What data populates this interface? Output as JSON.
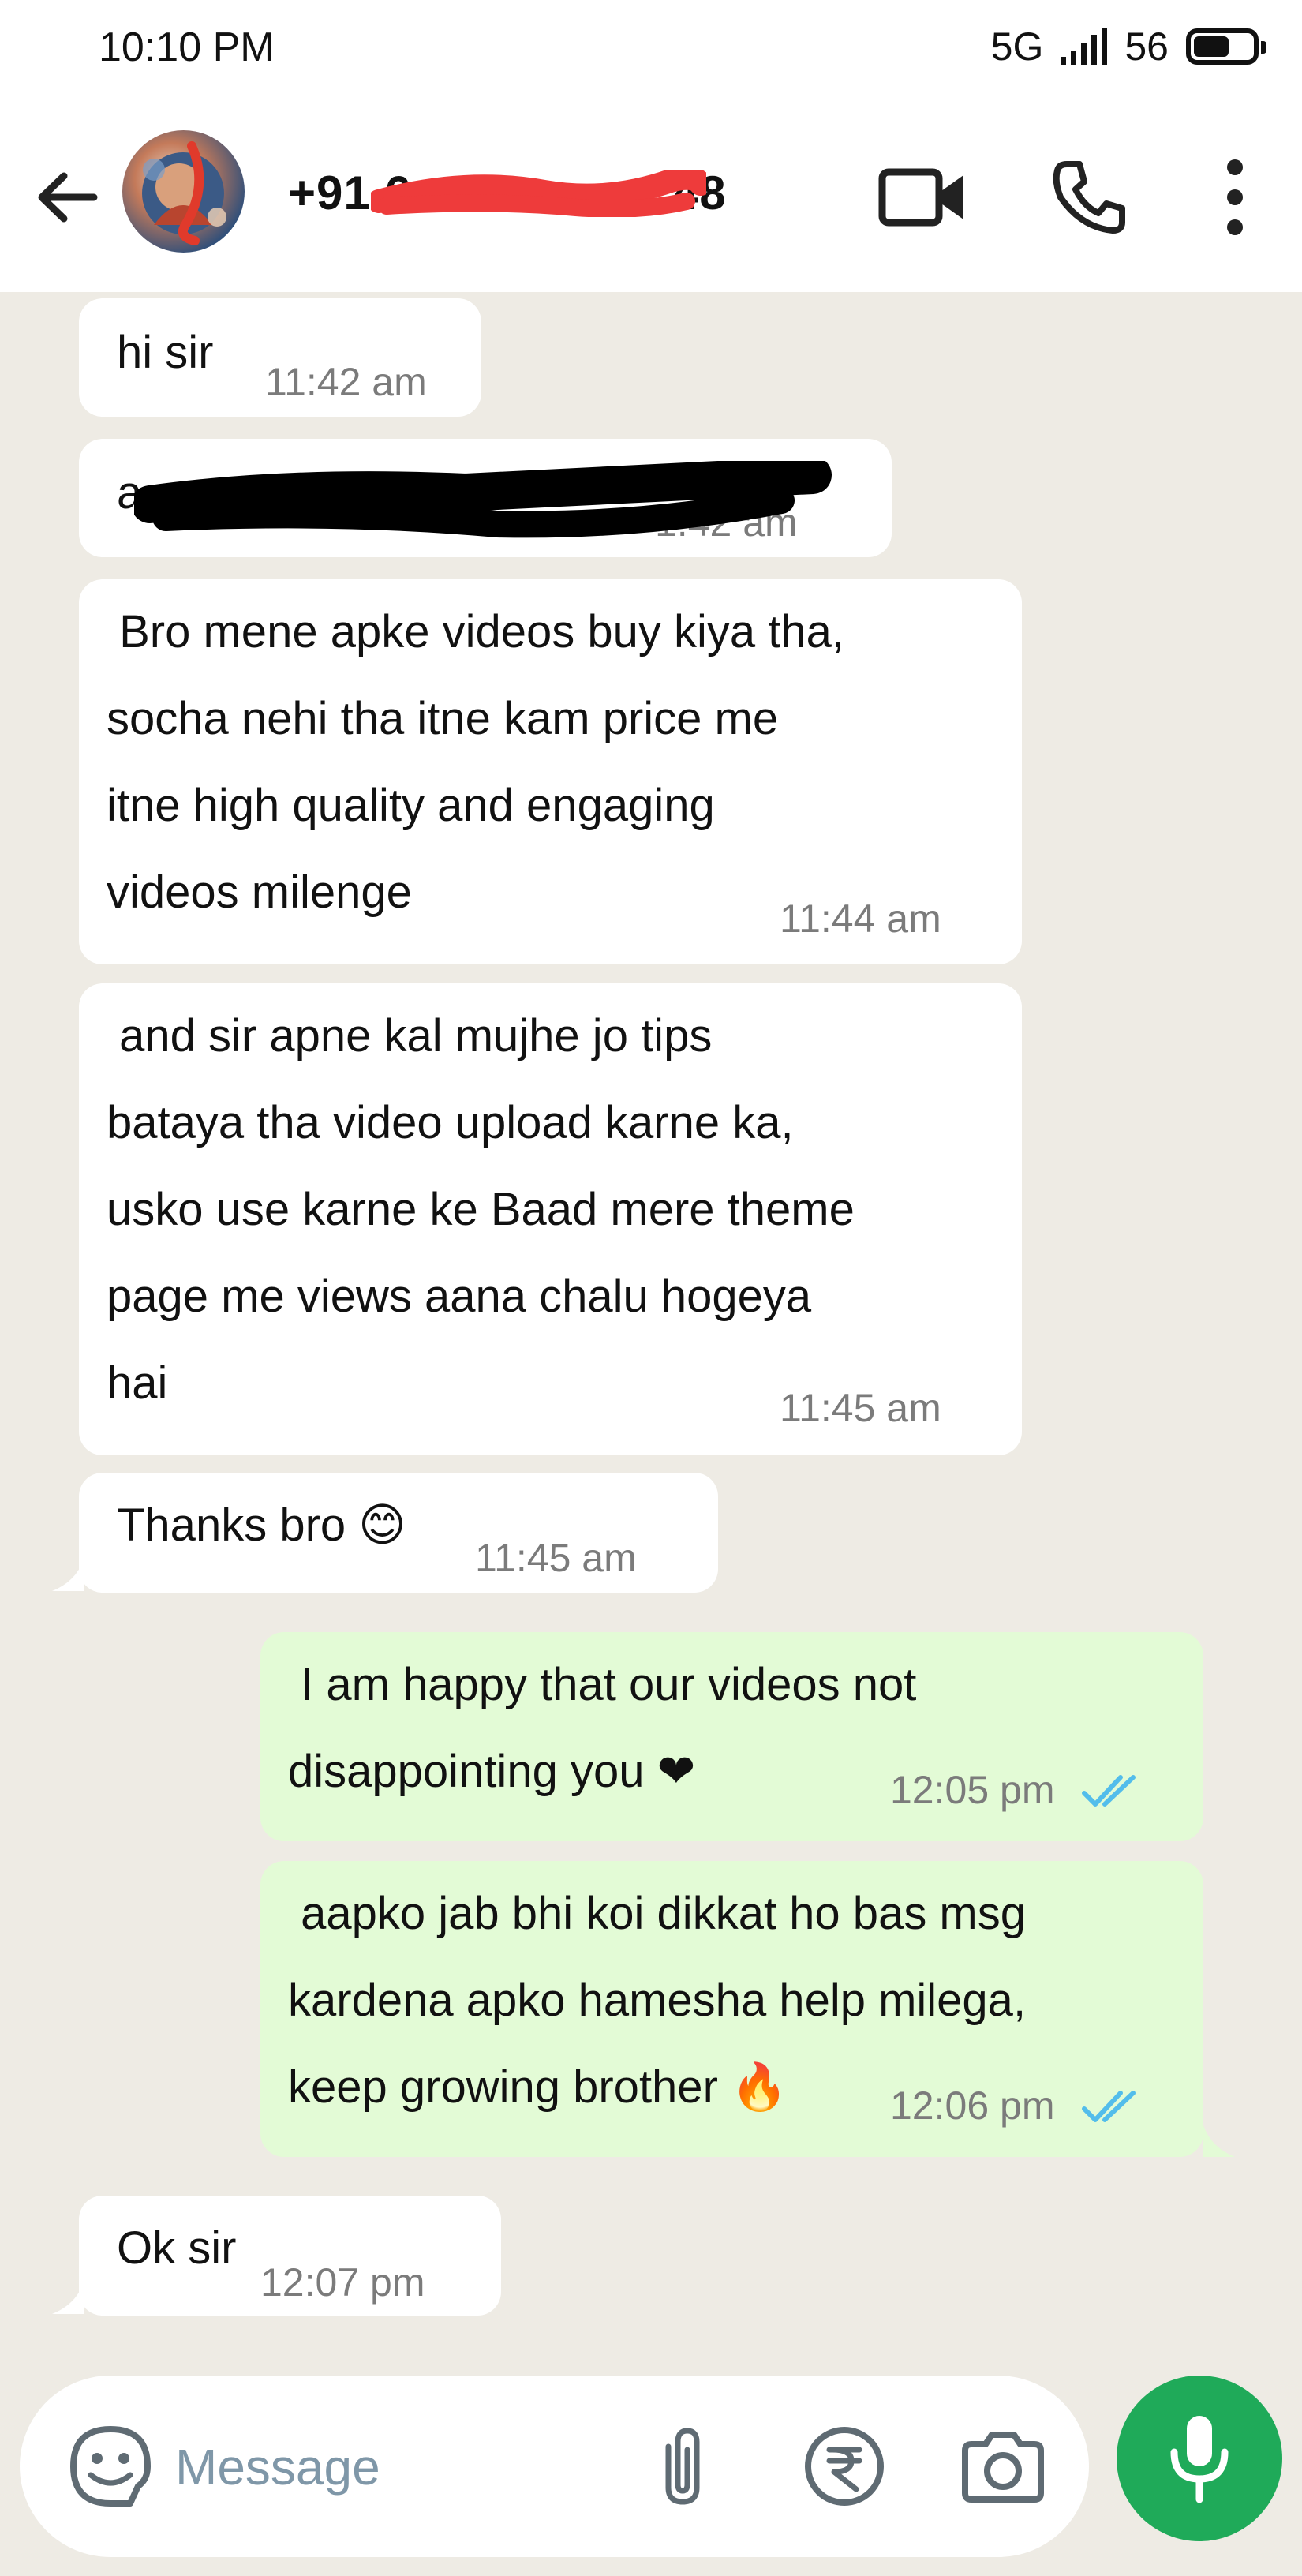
{
  "status_bar": {
    "time": "10:10 PM",
    "network": "5G",
    "battery": "56"
  },
  "header": {
    "contact_name": "+91 6",
    "contact_name_suffix": "48",
    "icons": [
      "back-arrow-icon",
      "video-call-icon",
      "phone-icon",
      "more-vert-icon"
    ]
  },
  "messages": [
    {
      "direction": "incoming",
      "text": "hi sir",
      "time": "11:42 am"
    },
    {
      "direction": "incoming",
      "text": "a",
      "time": "1:42 am"
    },
    {
      "direction": "incoming",
      "text": " Bro mene apke videos buy kiya tha,\nsocha nehi tha itne kam price me\nitne high quality and engaging\nvideos milenge",
      "time": "11:44 am"
    },
    {
      "direction": "incoming",
      "text": " and sir apne kal mujhe jo tips\nbataya tha video upload karne ka,\nusko use karne ke Baad mere theme\npage me views aana chalu hogeya\nhai",
      "time": "11:45 am"
    },
    {
      "direction": "incoming",
      "text": "Thanks bro 😊",
      "time": "11:45 am"
    },
    {
      "direction": "outgoing",
      "text": " I am happy that our videos not\ndisappointing you ❤",
      "time": "12:05 pm"
    },
    {
      "direction": "outgoing",
      "text": " aapko jab bhi koi dikkat ho bas msg\nkardena apko hamesha help milega,\nkeep growing brother 🔥",
      "time": "12:06 pm"
    },
    {
      "direction": "incoming",
      "text": "Ok sir",
      "time": "12:07 pm"
    }
  ],
  "composer": {
    "placeholder": "Message",
    "icons": [
      "sticker-icon",
      "attach-icon",
      "rupee-payment-icon",
      "camera-icon",
      "mic-icon"
    ]
  },
  "colors": {
    "chat_background": "#eeebe4",
    "incoming_bubble": "#ffffff",
    "outgoing_bubble": "#e3fbd6",
    "read_ticks": "#53bdeb",
    "mic_button": "#1faa59",
    "redaction_red": "#ee3b3b"
  }
}
